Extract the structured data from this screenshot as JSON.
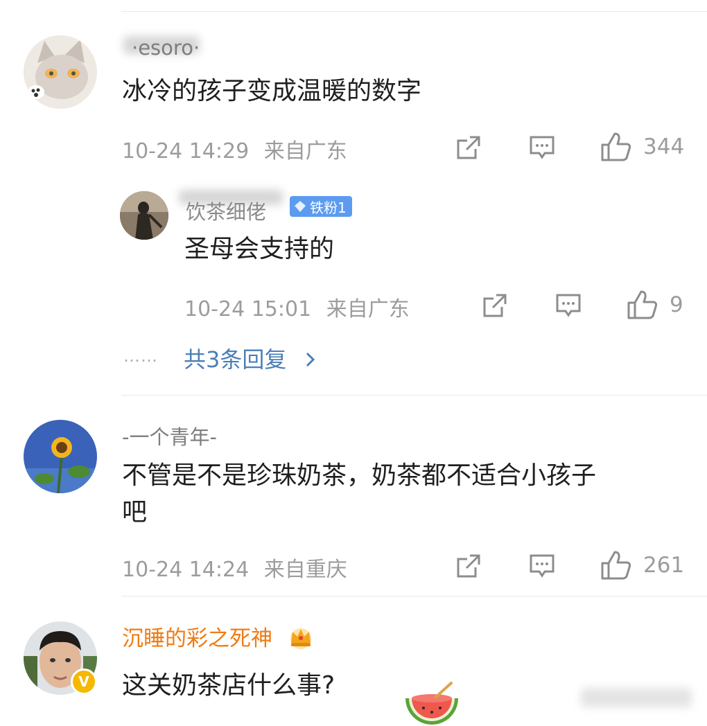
{
  "comments": [
    {
      "username": "·esoro·",
      "text": "冰冷的孩子变成温暖的数字",
      "time": "10-24 14:29",
      "location": "来自广东",
      "likes": "344",
      "reply": {
        "username": "饮茶细佬",
        "badge": "铁粉1",
        "text": "圣母会支持的",
        "time": "10-24 15:01",
        "location": "来自广东",
        "likes": "9"
      },
      "more_replies": "共3条回复",
      "dots": "……"
    },
    {
      "username": "-一个青年-",
      "text_line1": "不管是不是珍珠奶茶，奶茶都不适合小孩子",
      "text_line2": "吧",
      "time": "10-24 14:24",
      "location": "来自重庆",
      "likes": "261"
    },
    {
      "username": "沉睡的彩之死神",
      "text": "这关奶茶店什么事?",
      "verified": "V"
    }
  ],
  "colors": {
    "vip_name": "#f07b14",
    "link": "#4a7fb8",
    "badge": "#5c9bf0",
    "meta": "#9c9c9c"
  }
}
